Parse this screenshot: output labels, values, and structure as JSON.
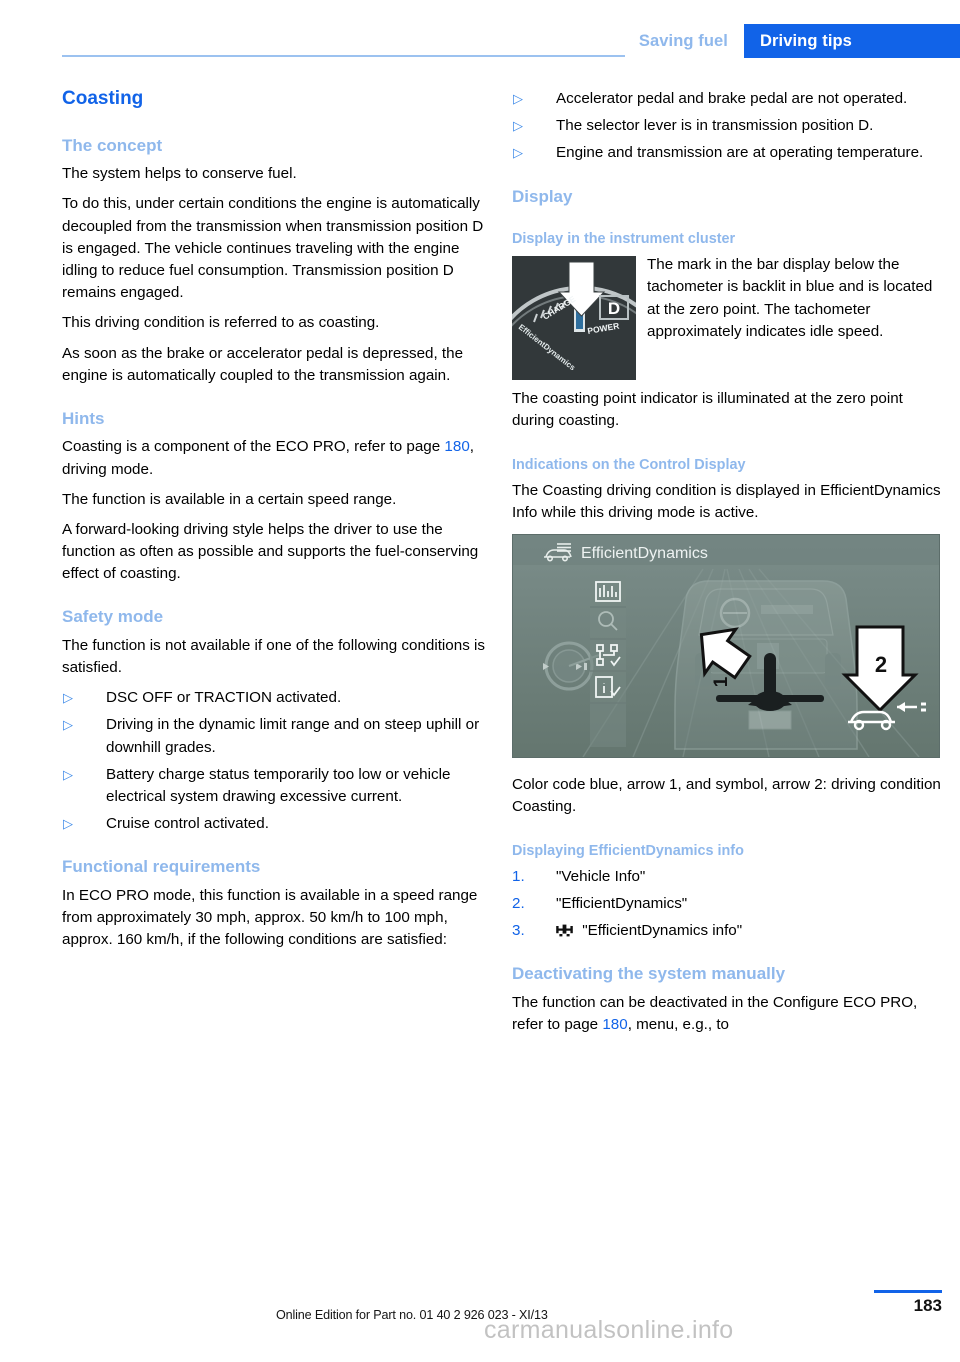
{
  "header": {
    "tab_inactive": "Saving fuel",
    "tab_active": "Driving tips",
    "accent_blue": "#1163e8",
    "light_blue": "#8fb8ec"
  },
  "left_column": {
    "section_title": "Coasting",
    "concept": {
      "heading": "The concept",
      "paragraphs": [
        "The system helps to conserve fuel.",
        "To do this, under certain conditions the engine is automatically decoupled from the transmission when transmission position D is engaged. The vehicle continues traveling with the engine idling to reduce fuel consumption. Transmission position D remains engaged.",
        "This driving condition is referred to as coasting.",
        "As soon as the brake or accelerator pedal is depressed, the engine is automatically coupled to the transmission again."
      ]
    },
    "hints": {
      "heading": "Hints",
      "para1_before": "Coasting is a component of the ECO PRO, refer to page ",
      "para1_page": "180",
      "para1_after": ", driving mode.",
      "paragraphs": [
        "The function is available in a certain speed range.",
        "A forward-looking driving style helps the driver to use the function as often as possible and supports the fuel-conserving effect of coasting."
      ]
    },
    "safety_mode": {
      "heading": "Safety mode",
      "intro": "The function is not available if one of the following conditions is satisfied.",
      "bullets": [
        "DSC OFF or TRACTION activated.",
        "Driving in the dynamic limit range and on steep uphill or downhill grades.",
        "Battery charge status temporarily too low or vehicle electrical system drawing excessive current.",
        "Cruise control activated."
      ]
    },
    "functional_requirements": {
      "heading": "Functional requirements",
      "intro": "In ECO PRO mode, this function is available in a speed range from approximately 30 mph, approx. 50 km/h to 100 mph, approx. 160 km/h, if the following conditions are satisfied:"
    }
  },
  "right_column": {
    "requirement_bullets": [
      "Accelerator pedal and brake pedal are not operated.",
      "The selector lever is in transmission position D.",
      "Engine and transmission are at operating temperature."
    ],
    "display": {
      "heading": "Display",
      "cluster_heading": "Display in the instrument cluster",
      "cluster_text": "The mark in the bar display below the tachometer is backlit in blue and is located at the zero point. The tachometer approximately indicates idle speed.",
      "cluster_followup": "The coasting point indicator is illuminated at the zero point during coasting.",
      "cluster_image": {
        "label_charge": "CHARGE",
        "label_power": "POWER",
        "label_efficientdynamics": "EfficientDynamics",
        "gear_indicator": "D",
        "background_color": "#32383a"
      }
    },
    "control_display": {
      "heading": "Indications on the Control Display",
      "text": "The Coasting driving condition is displayed in EfficientDynamics Info while this driving mode is active.",
      "image": {
        "title": "EfficientDynamics",
        "arrow_1_label": "1",
        "arrow_2_label": "2",
        "background_color": "#6e807d"
      },
      "caption": "Color code blue, arrow 1, and symbol, arrow 2: driving condition Coasting."
    },
    "displaying_info": {
      "heading": "Displaying EfficientDynamics info",
      "steps": [
        {
          "num": "1.",
          "label": "\"Vehicle Info\"",
          "icon": ""
        },
        {
          "num": "2.",
          "label": "\"EfficientDynamics\"",
          "icon": ""
        },
        {
          "num": "3.",
          "label": "\"EfficientDynamics info\"",
          "icon": "efficientdynamics-icon"
        }
      ]
    },
    "deactivating": {
      "heading": "Deactivating the system manually",
      "text_before": "The function can be deactivated in the Configure ECO PRO, refer to page ",
      "page": "180",
      "text_after": ", menu, e.g., to"
    }
  },
  "footer": {
    "note": "Online Edition for Part no. 01 40 2 926 023 - XI/13",
    "page_number": "183",
    "watermark": "carmanualsonline.info"
  }
}
